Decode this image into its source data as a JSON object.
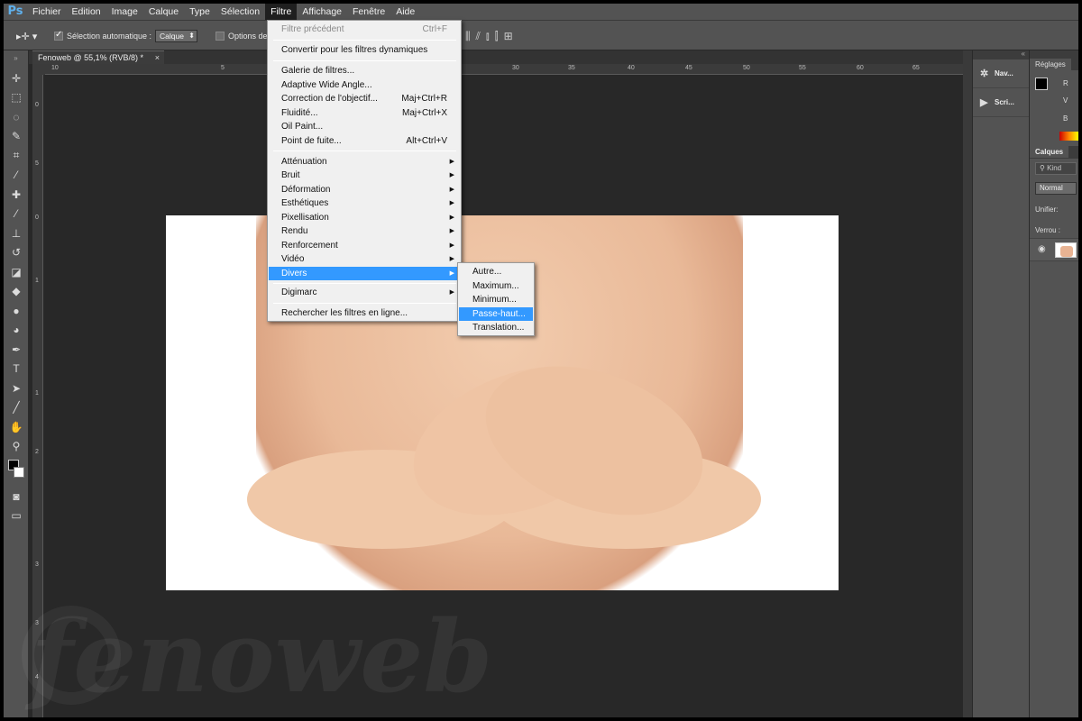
{
  "menubar": {
    "logo": "Ps",
    "items": [
      "Fichier",
      "Edition",
      "Image",
      "Calque",
      "Type",
      "Sélection",
      "Filtre",
      "Affichage",
      "Fenêtre",
      "Aide"
    ],
    "open_menu": "Filtre"
  },
  "options_bar": {
    "auto_select_label": "Sélection automatique :",
    "auto_select_checked": true,
    "auto_select_target": "Calque",
    "transform_options_label": "Options de"
  },
  "document": {
    "tab_title": "Fenoweb @ 55,1% (RVB/8) *",
    "close_glyph": "×",
    "zoom_percent": 55.1,
    "color_mode": "RVB/8"
  },
  "ruler": {
    "h_labels": [
      "10",
      "5",
      "30",
      "35",
      "40",
      "45",
      "50",
      "55",
      "60",
      "65"
    ],
    "v_labels": [
      "0",
      "5",
      "1",
      "1",
      "0",
      "1",
      "1",
      "5",
      "2",
      "2",
      "3",
      "3",
      "3",
      "4"
    ]
  },
  "filter_menu": {
    "items": [
      {
        "label": "Filtre précédent",
        "shortcut": "Ctrl+F",
        "disabled": true
      },
      {
        "sep": true
      },
      {
        "label": "Convertir pour les filtres dynamiques"
      },
      {
        "sep": true
      },
      {
        "label": "Galerie de filtres..."
      },
      {
        "label": "Adaptive Wide Angle..."
      },
      {
        "label": "Correction de l'objectif...",
        "shortcut": "Maj+Ctrl+R"
      },
      {
        "label": "Fluidité...",
        "shortcut": "Maj+Ctrl+X"
      },
      {
        "label": "Oil Paint..."
      },
      {
        "label": "Point de fuite...",
        "shortcut": "Alt+Ctrl+V"
      },
      {
        "sep": true
      },
      {
        "label": "Atténuation",
        "submenu": true
      },
      {
        "label": "Bruit",
        "submenu": true
      },
      {
        "label": "Déformation",
        "submenu": true
      },
      {
        "label": "Esthétiques",
        "submenu": true
      },
      {
        "label": "Pixellisation",
        "submenu": true
      },
      {
        "label": "Rendu",
        "submenu": true
      },
      {
        "label": "Renforcement",
        "submenu": true
      },
      {
        "label": "Vidéo",
        "submenu": true
      },
      {
        "label": "Divers",
        "submenu": true,
        "highlighted": true
      },
      {
        "sep": true
      },
      {
        "label": "Digimarc",
        "submenu": true
      },
      {
        "sep": true
      },
      {
        "label": "Rechercher les filtres en ligne..."
      }
    ]
  },
  "divers_submenu": {
    "items": [
      "Autre...",
      "Maximum...",
      "Minimum...",
      "Passe-haut...",
      "Translation..."
    ],
    "highlighted": "Passe-haut..."
  },
  "mini_panels": [
    {
      "icon": "navigator-icon",
      "glyph": "✲",
      "label": "Nav..."
    },
    {
      "icon": "play-icon",
      "glyph": "▶",
      "label": "Scri..."
    }
  ],
  "right_panel": {
    "adjust_tab": "Réglages",
    "channels": [
      "R",
      "V",
      "B"
    ],
    "layers_tab": "Calques",
    "kind_label": "Kind",
    "blend_mode": "Normal",
    "unify_label": "Unifier:",
    "lock_label": "Verrou :"
  },
  "watermark": "fenoweb",
  "colors": {
    "ui_dark": "#282828",
    "ui_panel": "#535353",
    "highlight": "#3399ff",
    "ps_blue": "#5fb0ec"
  }
}
